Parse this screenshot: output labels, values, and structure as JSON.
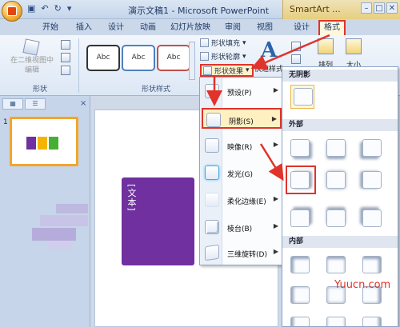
{
  "window": {
    "title": "演示文稿1 - Microsoft PowerPoint",
    "context_tab_group": "SmartArt ..."
  },
  "tabs": [
    "开始",
    "插入",
    "设计",
    "动画",
    "幻灯片放映",
    "审阅",
    "视图",
    "设计",
    "格式"
  ],
  "ribbon": {
    "shapes_group": {
      "edit_2d": "在二维视图中编辑",
      "label": "形状"
    },
    "shape_styles_group": {
      "styles": [
        "Abc",
        "Abc",
        "Abc"
      ],
      "fill": "形状填充",
      "outline": "形状轮廓",
      "effects": "形状效果",
      "label": "形状样式"
    },
    "art": {
      "quick_styles": "快速样式"
    },
    "arrange": "排列",
    "size": "大小"
  },
  "slide_panel": {
    "slide_number": "1"
  },
  "slide": {
    "vertical_text": "[文本]"
  },
  "effects_menu": {
    "items": [
      {
        "label": "预设(P)"
      },
      {
        "label": "阴影(S)"
      },
      {
        "label": "映像(R)"
      },
      {
        "label": "发光(G)"
      },
      {
        "label": "柔化边缘(E)"
      },
      {
        "label": "棱台(B)"
      },
      {
        "label": "三维旋转(D)"
      }
    ]
  },
  "shadow_submenu": {
    "no_shadow": "无阴影",
    "outer": "外部",
    "inner": "内部"
  },
  "watermark": "Yuucn.com",
  "colors": {
    "highlight": "#e0332a",
    "purple_shape": "#7030a0"
  }
}
